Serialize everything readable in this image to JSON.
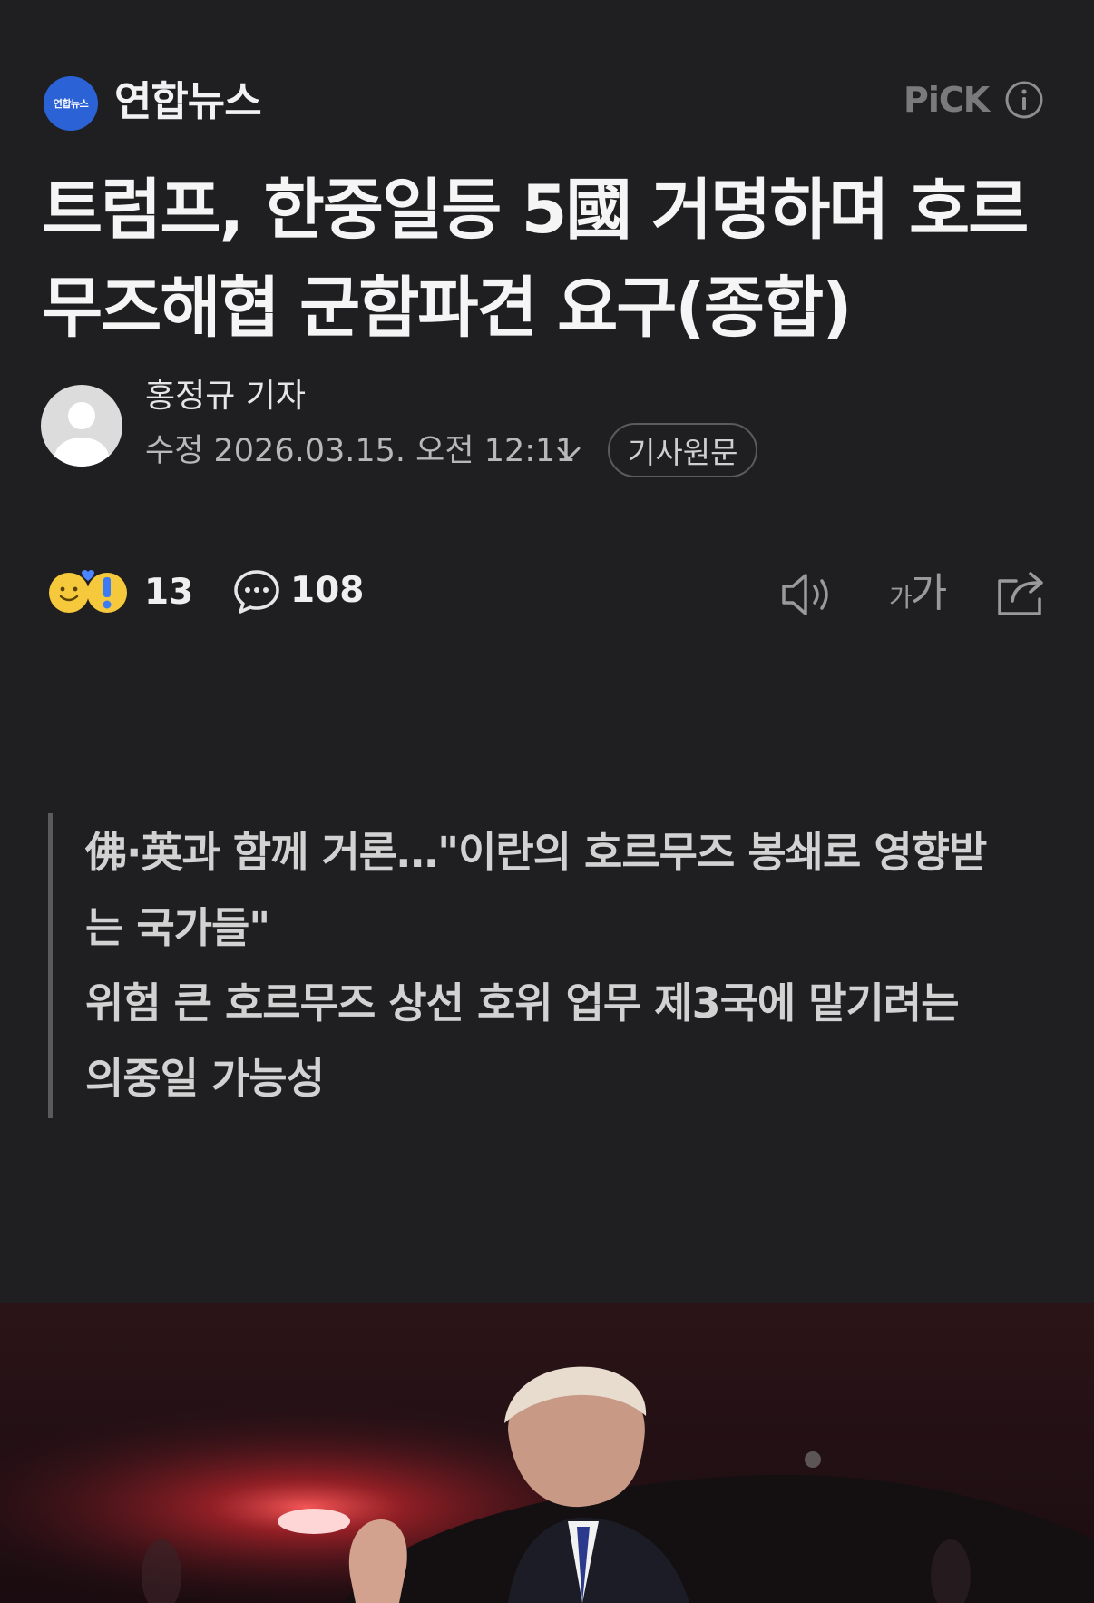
{
  "publisher": {
    "logo_text": "연합뉴스",
    "name": "연합뉴스",
    "pick_label": "PiCK"
  },
  "article": {
    "headline": "트럼프, 한중일등 5國 거명하며 호르무즈해협 군함파견 요구(종합)",
    "reporter": "홍정규 기자",
    "modified": "수정 2026.03.15. 오전 12:11",
    "original_button": "기사원문"
  },
  "stats": {
    "reactions": "13",
    "comments": "108"
  },
  "toolbar": {
    "font_size_small": "가",
    "font_size_large": "가"
  },
  "summary": [
    "佛·英과 함께 거론…\"이란의 호르무즈 봉쇄로 영향받는 국가들\"",
    "위험 큰 호르무즈 상선 호위 업무 제3국에 맡기려는 의중일 가능성"
  ],
  "colors": {
    "background": "#1f1f21",
    "logo_blue": "#2b62d6",
    "emoji_yellow": "#f6c83c"
  }
}
